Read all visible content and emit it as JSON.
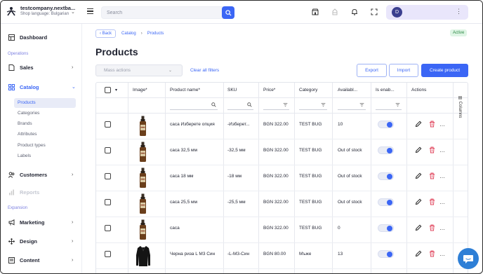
{
  "header": {
    "company_name": "testcompany.nextba...",
    "shop_language": "Shop language: Bulgarian",
    "search_placeholder": "Search",
    "user_initial": "D"
  },
  "sidebar": {
    "dashboard": "Dashboard",
    "operations_section": "Operations",
    "sales": "Sales",
    "catalog": "Catalog",
    "catalog_items": [
      "Products",
      "Categories",
      "Brands",
      "Attributes",
      "Product types",
      "Labels"
    ],
    "customers": "Customers",
    "reports": "Reports",
    "expansion_section": "Expansion",
    "marketing": "Marketing",
    "design": "Design",
    "content": "Content"
  },
  "breadcrumb": {
    "back": "Back",
    "catalog": "Catalog",
    "products": "Products"
  },
  "status_badge": "Active",
  "page_title": "Products",
  "toolbar": {
    "mass_actions": "Mass actions",
    "clear_filters": "Clear all filters",
    "export": "Export",
    "import": "Import",
    "create_product": "Create product"
  },
  "table": {
    "columns": [
      "Image*",
      "Product name*",
      "SKU",
      "Price*",
      "Category",
      "Availabl...",
      "Is enab...",
      "Actions"
    ],
    "columns_button": "Columns",
    "rows": [
      {
        "name": "саса Изберете опция",
        "sku": "-Изберет...",
        "price": "BGN 322.00",
        "category": "TEST BUG",
        "availability": "10",
        "enabled": true,
        "image": "bottle"
      },
      {
        "name": "саса 32,5 мм",
        "sku": "-32,5 мм",
        "price": "BGN 322.00",
        "category": "TEST BUG",
        "availability": "Out of stock",
        "enabled": true,
        "image": "bottle"
      },
      {
        "name": "саса 18 мм",
        "sku": "-18 мм",
        "price": "BGN 322.00",
        "category": "TEST BUG",
        "availability": "Out of stock",
        "enabled": true,
        "image": "bottle"
      },
      {
        "name": "саса 25,5 мм",
        "sku": "-25,5 мм",
        "price": "BGN 322.00",
        "category": "TEST BUG",
        "availability": "Out of stock",
        "enabled": true,
        "image": "bottle"
      },
      {
        "name": "саса",
        "sku": "",
        "price": "BGN 322.00",
        "category": "TEST BUG",
        "availability": "0",
        "enabled": true,
        "image": "bottle"
      },
      {
        "name": "Черна риза L M3 Син",
        "sku": "-L-M3-Син",
        "price": "BGN 80.00",
        "category": "Мъже",
        "availability": "13",
        "enabled": true,
        "image": "shirt"
      }
    ]
  },
  "colors": {
    "accent": "#3b66f5",
    "delete": "#e0445c",
    "active_badge_bg": "#dff5e5"
  }
}
